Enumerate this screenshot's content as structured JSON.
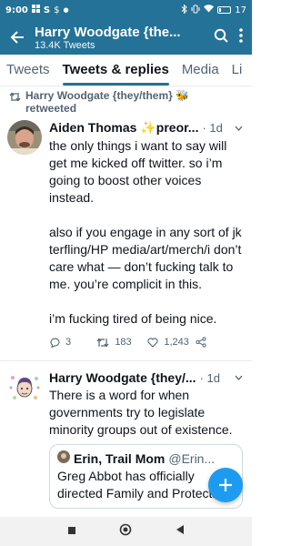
{
  "status_bar": {
    "time": "9:00",
    "battery": "17",
    "icons": [
      "grid-icon",
      "s-icon",
      "dollar-icon",
      "dot-icon",
      "bluetooth-icon",
      "vibrate-icon",
      "wifi-icon",
      "battery-icon"
    ]
  },
  "app_bar": {
    "title": "Harry Woodgate {the...",
    "subtitle": "13.4K Tweets",
    "color": "#247297"
  },
  "tabs": [
    {
      "label": "Tweets",
      "active": false
    },
    {
      "label": "Tweets & replies",
      "active": true
    },
    {
      "label": "Media",
      "active": false
    },
    {
      "label": "Li",
      "active": false
    }
  ],
  "retweet": {
    "text": "Harry Woodgate {they/them} 🐝 retweeted"
  },
  "tweet1": {
    "name": "Aiden Thomas ✨preor...",
    "time": "· 1d",
    "paragraphs": [
      "the only things i want to say will get me kicked off twitter. so i’m going to boost other voices instead.",
      "also if you engage in any sort of jk terfling/HP media/art/merch/i don’t care what — don’t fucking talk to me. you’re complicit in this.",
      "i’m fucking tired of being nice."
    ],
    "reply_count": "3",
    "retweet_count": "183",
    "like_count": "1,243"
  },
  "tweet2": {
    "name": "Harry Woodgate {they/...",
    "time": "· 1d",
    "text": "There is a word for when governments try to legislate minority groups out of existence.",
    "quote": {
      "name": "Erin, Trail Mom",
      "handle": "@Erin...",
      "text": "Greg Abbot has officially directed Family and Protective"
    }
  },
  "accent": "#1d9bf0"
}
